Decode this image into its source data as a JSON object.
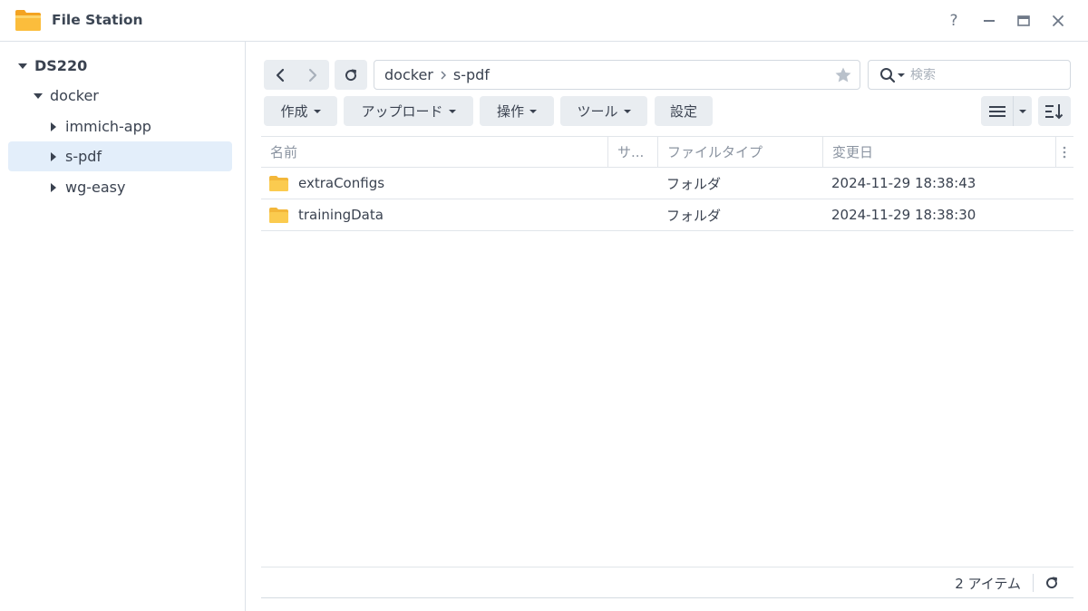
{
  "window": {
    "title": "File Station",
    "app_icon": "folder-icon",
    "controls": {
      "help": "?",
      "minimize": "minimize-icon",
      "maximize": "maximize-icon",
      "close": "close-icon"
    }
  },
  "sidebar": {
    "root": {
      "label": "DS220",
      "expanded": true
    },
    "items": [
      {
        "label": "docker",
        "expanded": true
      },
      {
        "label": "immich-app",
        "expanded": false
      },
      {
        "label": "s-pdf",
        "expanded": false,
        "selected": true
      },
      {
        "label": "wg-easy",
        "expanded": false
      }
    ]
  },
  "toolbar": {
    "back_icon": "chevron-left-icon",
    "forward_icon": "chevron-right-icon",
    "refresh_icon": "refresh-icon",
    "path": [
      "docker",
      "s-pdf"
    ],
    "favorite_icon": "star-icon",
    "search": {
      "placeholder": "検索",
      "value": ""
    },
    "buttons": {
      "create": "作成",
      "upload": "アップロード",
      "action": "操作",
      "tools": "ツール",
      "settings": "設定"
    },
    "view_icon": "list-view-icon",
    "sort_icon": "sort-icon"
  },
  "table": {
    "columns": {
      "name": "名前",
      "size": "サ...",
      "type": "ファイルタイプ",
      "modified": "変更日"
    },
    "rows": [
      {
        "name": "extraConfigs",
        "size": "",
        "type": "フォルダ",
        "modified": "2024-11-29 18:38:43"
      },
      {
        "name": "trainingData",
        "size": "",
        "type": "フォルダ",
        "modified": "2024-11-29 18:38:30"
      }
    ]
  },
  "footer": {
    "item_count": "2 アイテム"
  },
  "colors": {
    "accent_selected": "#e3eefa",
    "folder": "#f6c343",
    "button_bg": "#e9edf1",
    "border": "#e1e5ea"
  }
}
